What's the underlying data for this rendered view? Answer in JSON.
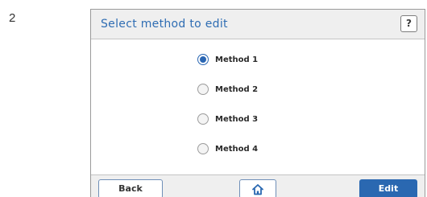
{
  "step_number": "2",
  "header": {
    "title": "Select method to edit",
    "help_label": "?"
  },
  "methods": [
    {
      "label": "Method 1",
      "selected": true
    },
    {
      "label": "Method 2",
      "selected": false
    },
    {
      "label": "Method 3",
      "selected": false
    },
    {
      "label": "Method 4",
      "selected": false
    }
  ],
  "footer": {
    "back_label": "Back",
    "home_icon": "home-icon",
    "edit_label": "Edit"
  },
  "colors": {
    "accent": "#2a68b1",
    "title": "#2f6db3",
    "bar_bg": "#efefef"
  }
}
